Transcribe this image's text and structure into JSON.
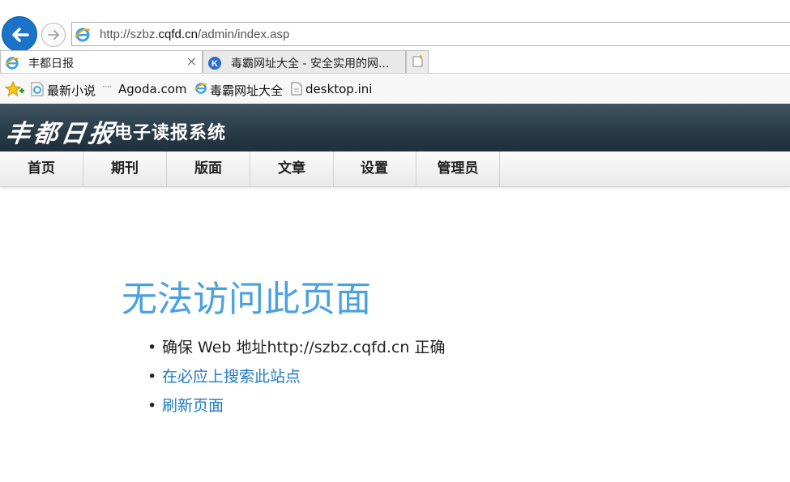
{
  "browser": {
    "address": {
      "prefix": "http://szbz.",
      "domain": "cqfd.cn",
      "suffix": "/admin/index.asp"
    },
    "tabs": [
      {
        "label": "丰都日报",
        "active": true,
        "close": "×"
      },
      {
        "label": "毒霸网址大全 - 安全实用的网...",
        "active": false
      }
    ],
    "favorites": [
      {
        "label": "最新小说",
        "icon": "ie-page-icon"
      },
      {
        "label": "Agoda.com",
        "icon": "dots-icon"
      },
      {
        "label": "毒霸网址大全",
        "icon": "ie-icon"
      },
      {
        "label": "desktop.ini",
        "icon": "file-icon"
      }
    ]
  },
  "site": {
    "logo_brush": "丰都日报",
    "logo_sub": "电子读报系统",
    "nav": [
      "首页",
      "期刊",
      "版面",
      "文章",
      "设置",
      "管理员"
    ]
  },
  "error": {
    "title": "无法访问此页面",
    "tip": "确保 Web 地址http://szbz.cqfd.cn 正确",
    "links": [
      "在必应上搜索此站点",
      "刷新页面"
    ]
  },
  "colors": {
    "accent": "#1a73c8",
    "error_title": "#4aa1e0",
    "link": "#1e7bc6",
    "header_bg": "#2b3d4a"
  }
}
